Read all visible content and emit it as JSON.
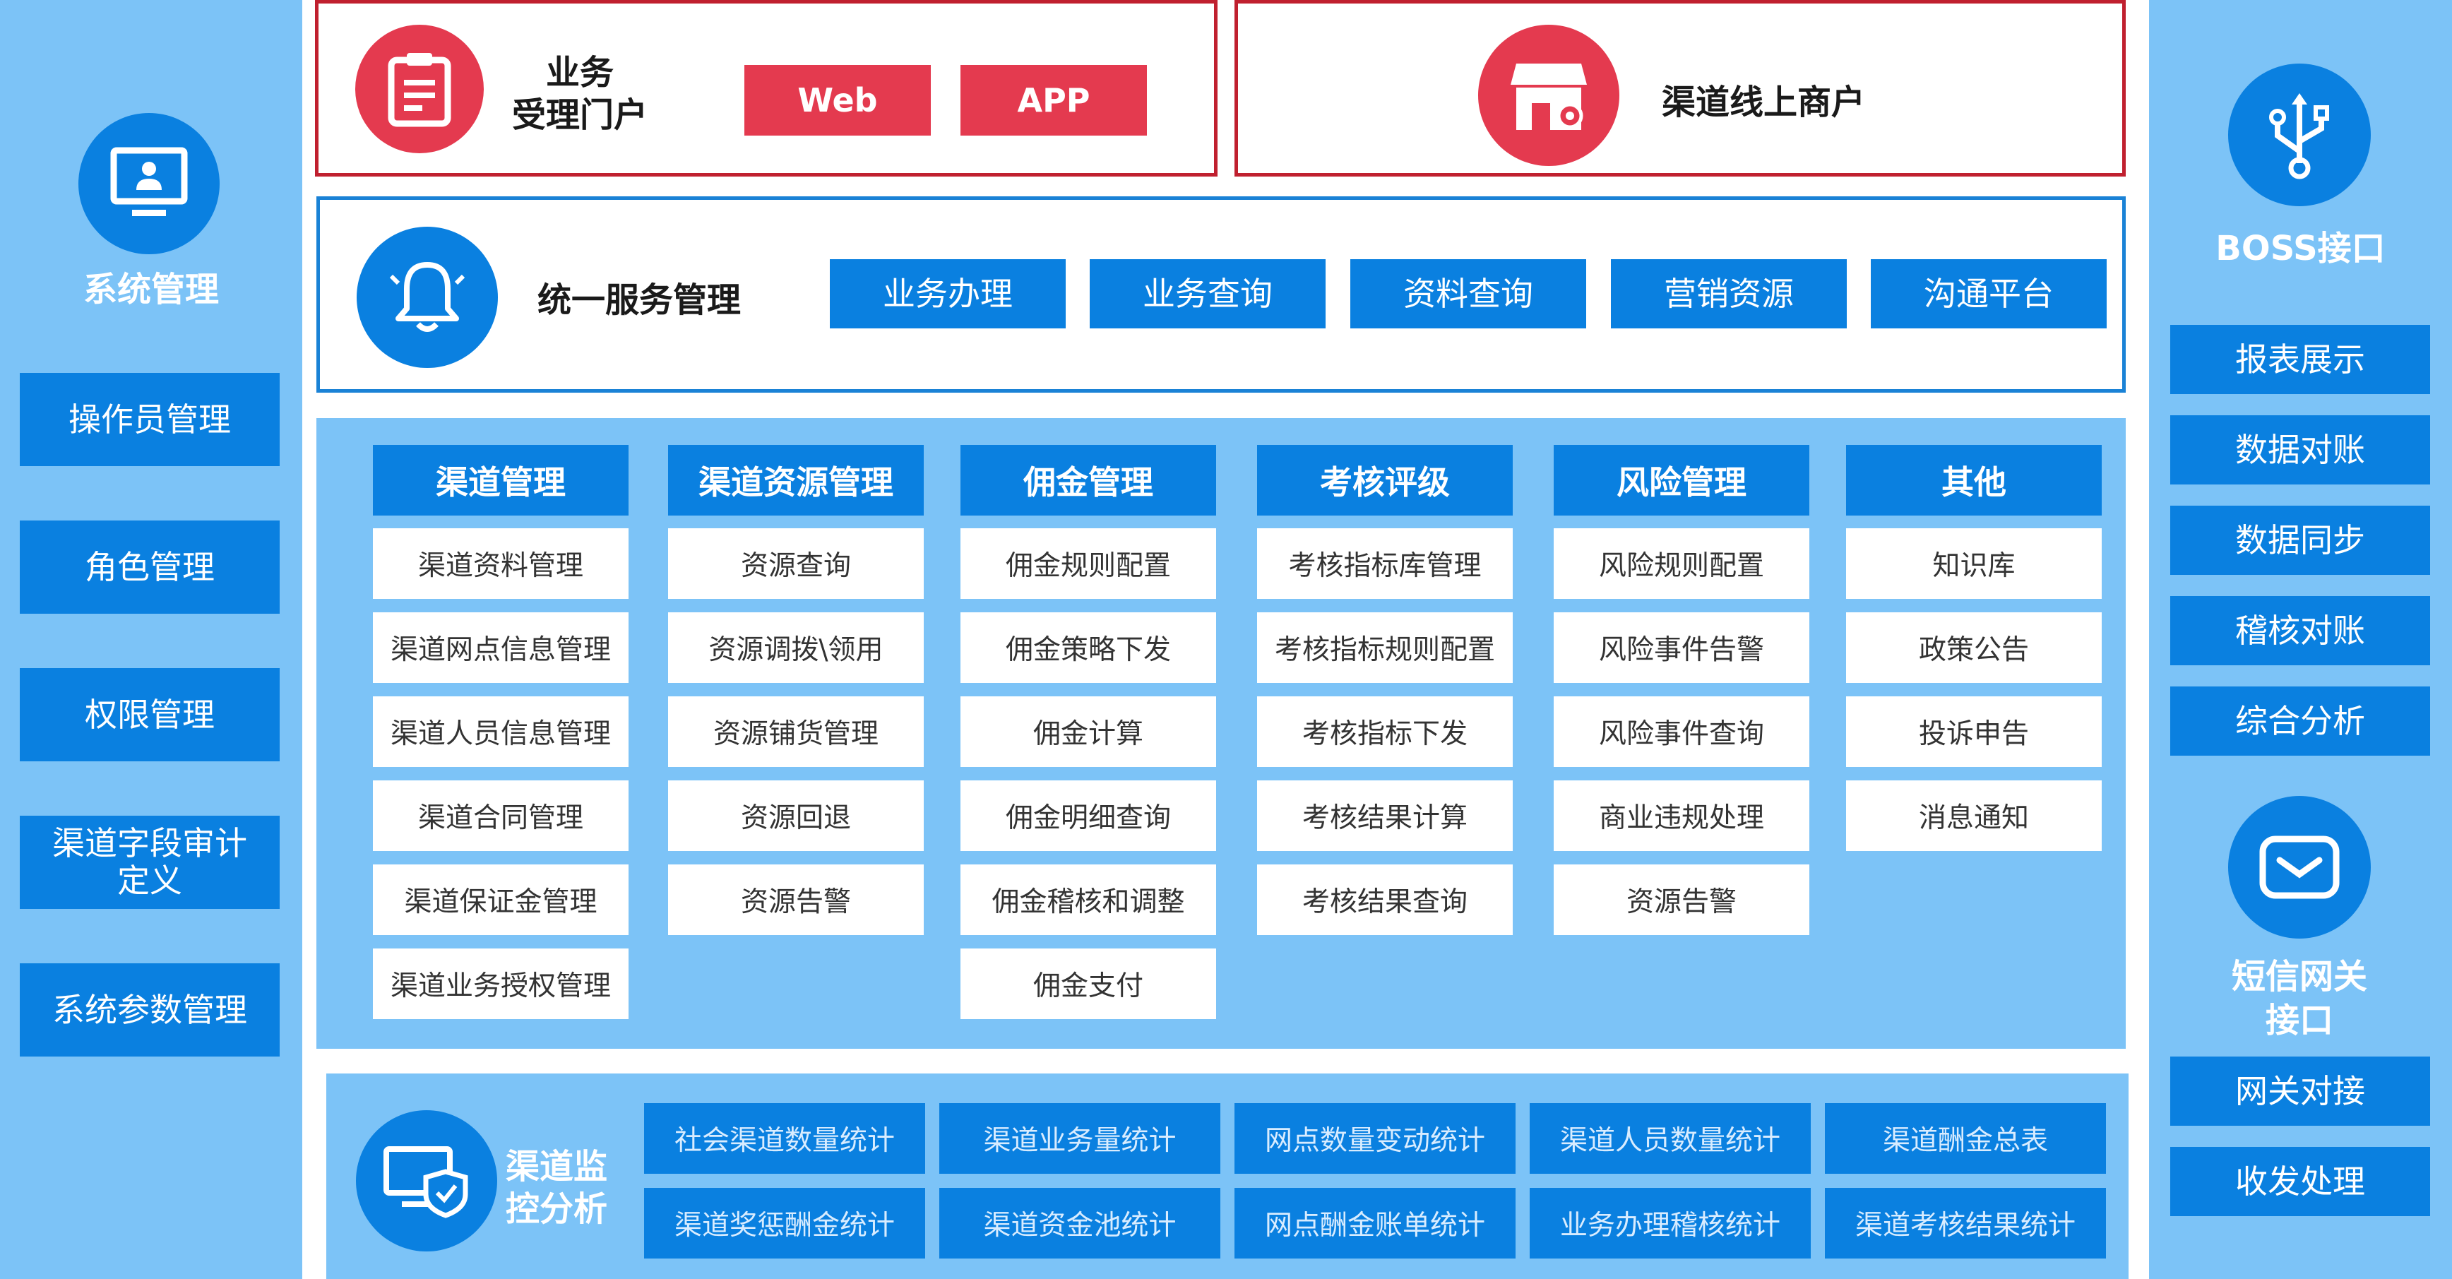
{
  "left": {
    "title": "系统管理",
    "items": [
      "操作员管理",
      "角色管理",
      "权限管理",
      "渠道字段审计定义",
      "系统参数管理"
    ]
  },
  "right": {
    "boss_title": "BOSS接口",
    "boss_items": [
      "报表展示",
      "数据对账",
      "数据同步",
      "稽核对账",
      "综合分析"
    ],
    "sms_title": "短信网关接口",
    "sms_items": [
      "网关对接",
      "收发处理"
    ]
  },
  "portal": {
    "title_line1": "业务",
    "title_line2": "受理门户",
    "buttons": [
      "Web",
      "APP"
    ]
  },
  "merchant": {
    "title": "渠道线上商户"
  },
  "service": {
    "title": "统一服务管理",
    "items": [
      "业务办理",
      "业务查询",
      "资料查询",
      "营销资源",
      "沟通平台"
    ]
  },
  "modules": [
    {
      "header": "渠道管理",
      "items": [
        "渠道资料管理",
        "渠道网点信息管理",
        "渠道人员信息管理",
        "渠道合同管理",
        "渠道保证金管理",
        "渠道业务授权管理"
      ]
    },
    {
      "header": "渠道资源管理",
      "items": [
        "资源查询",
        "资源调拨\\领用",
        "资源铺货管理",
        "资源回退",
        "资源告警"
      ]
    },
    {
      "header": "佣金管理",
      "items": [
        "佣金规则配置",
        "佣金策略下发",
        "佣金计算",
        "佣金明细查询",
        "佣金稽核和调整",
        "佣金支付"
      ]
    },
    {
      "header": "考核评级",
      "items": [
        "考核指标库管理",
        "考核指标规则配置",
        "考核指标下发",
        "考核结果计算",
        "考核结果查询"
      ]
    },
    {
      "header": "风险管理",
      "items": [
        "风险规则配置",
        "风险事件告警",
        "风险事件查询",
        "商业违规处理",
        "资源告警"
      ]
    },
    {
      "header": "其他",
      "items": [
        "知识库",
        "政策公告",
        "投诉申告",
        "消息通知"
      ]
    }
  ],
  "monitor": {
    "title_line1": "渠道监",
    "title_line2": "控分析",
    "row1": [
      "社会渠道数量统计",
      "渠道业务量统计",
      "网点数量变动统计",
      "渠道人员数量统计",
      "渠道酬金总表"
    ],
    "row2": [
      "渠道奖惩酬金统计",
      "渠道资金池统计",
      "网点酬金账单统计",
      "业务办理稽核统计",
      "渠道考核结果统计"
    ]
  },
  "colors": {
    "accent_blue": "#0a80e0",
    "light_blue": "#7cc3f7",
    "red": "#e43a4f"
  }
}
